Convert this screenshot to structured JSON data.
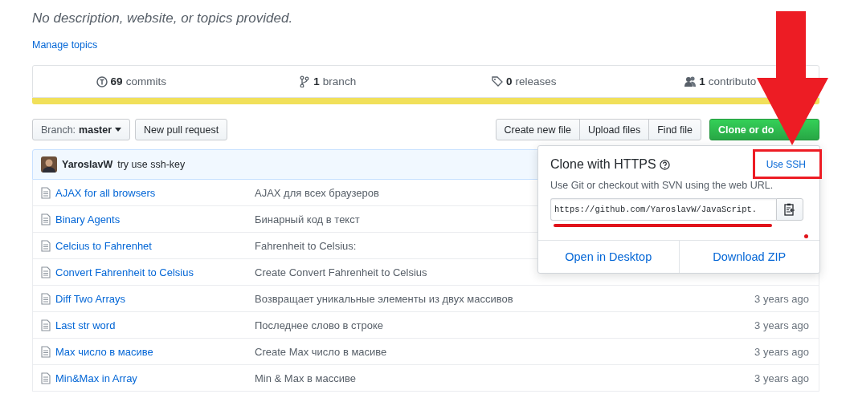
{
  "description": "No description, website, or topics provided.",
  "manage_topics": "Manage topics",
  "stats": [
    {
      "kind": "commits",
      "count": "69",
      "label": "commits"
    },
    {
      "kind": "branch",
      "count": "1",
      "label": "branch"
    },
    {
      "kind": "releases",
      "count": "0",
      "label": "releases"
    },
    {
      "kind": "contributors",
      "count": "1",
      "label": "contributo"
    }
  ],
  "toolbar": {
    "branch_label": "Branch:",
    "branch": "master",
    "new_pull_request": "New pull request",
    "file_buttons": [
      "Create new file",
      "Upload files",
      "Find file"
    ],
    "clone_button": "Clone or do"
  },
  "latest_commit": {
    "author": "YaroslavW",
    "message": "try use ssh-key"
  },
  "files": [
    {
      "name": "AJAX for all browsers",
      "message": "AJAX для всех браузеров"
    },
    {
      "name": "Binary Agents",
      "message": "Бинарный код в текст"
    },
    {
      "name": "Celcius to Fahrenhet",
      "message": "Fahrenheit to Celsius:"
    },
    {
      "name": "Convert Fahrenheit to Celsius",
      "message": "Create Convert Fahrenheit to Celsius"
    },
    {
      "name": "Diff Two Arrays",
      "message": "Возвращает уникальные элементы из двух массивов",
      "age": "3 years ago"
    },
    {
      "name": "Last str word",
      "message": "Последнее слово в строке",
      "age": "3 years ago"
    },
    {
      "name": "Max число в масиве",
      "message": "Create Max число в масиве",
      "age": "3 years ago"
    },
    {
      "name": "Min&Max in Array",
      "message": "Min & Max в массиве",
      "age": "3 years ago"
    }
  ],
  "clone_popup": {
    "title": "Clone with HTTPS",
    "use_ssh": "Use SSH",
    "hint": "Use Git or checkout with SVN using the web URL.",
    "url": "https://github.com/YaroslavW/JavaScript.",
    "actions": [
      "Open in Desktop",
      "Download ZIP"
    ]
  },
  "annotations": [
    {
      "kind": "arrow"
    },
    {
      "kind": "frame"
    },
    {
      "kind": "underline"
    },
    {
      "kind": "dot"
    }
  ]
}
